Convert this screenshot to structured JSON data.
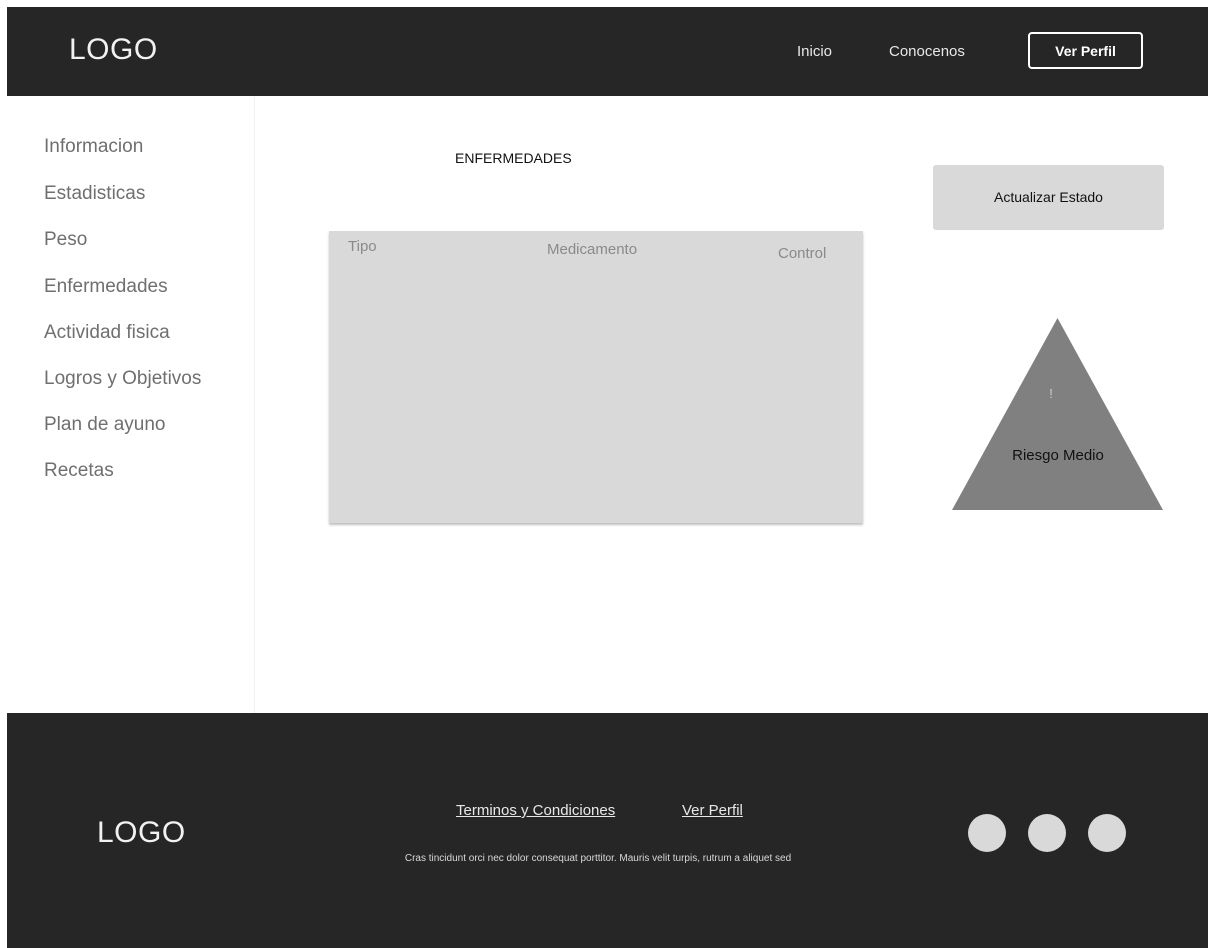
{
  "header": {
    "logo": "LOGO",
    "nav": {
      "inicio": "Inicio",
      "conocenos": "Conocenos",
      "ver_perfil": "Ver Perfil"
    }
  },
  "sidebar": {
    "items": [
      {
        "label": "Informacion"
      },
      {
        "label": "Estadisticas"
      },
      {
        "label": "Peso"
      },
      {
        "label": "Enfermedades"
      },
      {
        "label": "Actividad fisica"
      },
      {
        "label": "Logros y Objetivos"
      },
      {
        "label": "Plan de ayuno"
      },
      {
        "label": "Recetas"
      }
    ]
  },
  "main": {
    "title": "ENFERMEDADES",
    "table": {
      "columns": [
        "Tipo",
        "Medicamento",
        "Control"
      ]
    },
    "update_button": {
      "label": "Actualizar Estado"
    },
    "risk": {
      "symbol": "!",
      "label": "Riesgo Medio",
      "color": "#808080"
    }
  },
  "footer": {
    "logo": "LOGO",
    "links": {
      "terminos": "Terminos y Condiciones",
      "ver_perfil": "Ver Perfil"
    },
    "text": "Cras tincidunt orci nec dolor consequat porttitor. Mauris velit turpis, rutrum a aliquet sed",
    "social_icons": [
      "social-icon-1",
      "social-icon-2",
      "social-icon-3"
    ]
  },
  "colors": {
    "header_bg": "#262626",
    "panel_gray": "#d9d9d9",
    "sidebar_text": "#6f6f6f"
  }
}
